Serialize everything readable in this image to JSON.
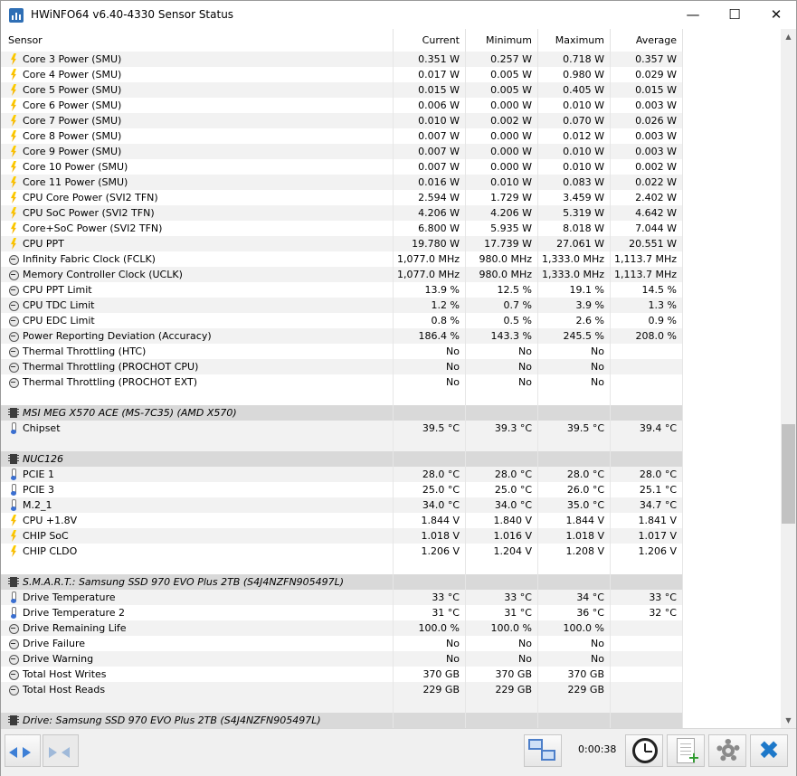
{
  "window": {
    "title": "HWiNFO64 v6.40-4330 Sensor Status",
    "controls": {
      "minimize": "—",
      "maximize": "☐",
      "close": "✕"
    }
  },
  "columns": {
    "sensor": "Sensor",
    "current": "Current",
    "minimum": "Minimum",
    "maximum": "Maximum",
    "average": "Average"
  },
  "rows": [
    {
      "kind": "sensor",
      "icon": "power",
      "name": "Core 3 Power (SMU)",
      "cur": "0.351 W",
      "min": "0.257 W",
      "max": "0.718 W",
      "avg": "0.357 W"
    },
    {
      "kind": "sensor",
      "icon": "power",
      "name": "Core 4 Power (SMU)",
      "cur": "0.017 W",
      "min": "0.005 W",
      "max": "0.980 W",
      "avg": "0.029 W"
    },
    {
      "kind": "sensor",
      "icon": "power",
      "name": "Core 5 Power (SMU)",
      "cur": "0.015 W",
      "min": "0.005 W",
      "max": "0.405 W",
      "avg": "0.015 W"
    },
    {
      "kind": "sensor",
      "icon": "power",
      "name": "Core 6 Power (SMU)",
      "cur": "0.006 W",
      "min": "0.000 W",
      "max": "0.010 W",
      "avg": "0.003 W"
    },
    {
      "kind": "sensor",
      "icon": "power",
      "name": "Core 7 Power (SMU)",
      "cur": "0.010 W",
      "min": "0.002 W",
      "max": "0.070 W",
      "avg": "0.026 W"
    },
    {
      "kind": "sensor",
      "icon": "power",
      "name": "Core 8 Power (SMU)",
      "cur": "0.007 W",
      "min": "0.000 W",
      "max": "0.012 W",
      "avg": "0.003 W"
    },
    {
      "kind": "sensor",
      "icon": "power",
      "name": "Core 9 Power (SMU)",
      "cur": "0.007 W",
      "min": "0.000 W",
      "max": "0.010 W",
      "avg": "0.003 W"
    },
    {
      "kind": "sensor",
      "icon": "power",
      "name": "Core 10 Power (SMU)",
      "cur": "0.007 W",
      "min": "0.000 W",
      "max": "0.010 W",
      "avg": "0.002 W"
    },
    {
      "kind": "sensor",
      "icon": "power",
      "name": "Core 11 Power (SMU)",
      "cur": "0.016 W",
      "min": "0.010 W",
      "max": "0.083 W",
      "avg": "0.022 W"
    },
    {
      "kind": "sensor",
      "icon": "power",
      "name": "CPU Core Power (SVI2 TFN)",
      "cur": "2.594 W",
      "min": "1.729 W",
      "max": "3.459 W",
      "avg": "2.402 W"
    },
    {
      "kind": "sensor",
      "icon": "power",
      "name": "CPU SoC Power (SVI2 TFN)",
      "cur": "4.206 W",
      "min": "4.206 W",
      "max": "5.319 W",
      "avg": "4.642 W"
    },
    {
      "kind": "sensor",
      "icon": "power",
      "name": "Core+SoC Power (SVI2 TFN)",
      "cur": "6.800 W",
      "min": "5.935 W",
      "max": "8.018 W",
      "avg": "7.044 W"
    },
    {
      "kind": "sensor",
      "icon": "power",
      "name": "CPU PPT",
      "cur": "19.780 W",
      "min": "17.739 W",
      "max": "27.061 W",
      "avg": "20.551 W"
    },
    {
      "kind": "sensor",
      "icon": "clock",
      "name": "Infinity Fabric Clock (FCLK)",
      "cur": "1,077.0 MHz",
      "min": "980.0 MHz",
      "max": "1,333.0 MHz",
      "avg": "1,113.7 MHz"
    },
    {
      "kind": "sensor",
      "icon": "clock",
      "name": "Memory Controller Clock (UCLK)",
      "cur": "1,077.0 MHz",
      "min": "980.0 MHz",
      "max": "1,333.0 MHz",
      "avg": "1,113.7 MHz"
    },
    {
      "kind": "sensor",
      "icon": "clock",
      "name": "CPU PPT Limit",
      "cur": "13.9 %",
      "min": "12.5 %",
      "max": "19.1 %",
      "avg": "14.5 %"
    },
    {
      "kind": "sensor",
      "icon": "clock",
      "name": "CPU TDC Limit",
      "cur": "1.2 %",
      "min": "0.7 %",
      "max": "3.9 %",
      "avg": "1.3 %"
    },
    {
      "kind": "sensor",
      "icon": "clock",
      "name": "CPU EDC Limit",
      "cur": "0.8 %",
      "min": "0.5 %",
      "max": "2.6 %",
      "avg": "0.9 %"
    },
    {
      "kind": "sensor",
      "icon": "clock",
      "name": "Power Reporting Deviation (Accuracy)",
      "cur": "186.4 %",
      "min": "143.3 %",
      "max": "245.5 %",
      "avg": "208.0 %"
    },
    {
      "kind": "sensor",
      "icon": "clock",
      "name": "Thermal Throttling (HTC)",
      "cur": "No",
      "min": "No",
      "max": "No",
      "avg": ""
    },
    {
      "kind": "sensor",
      "icon": "clock",
      "name": "Thermal Throttling (PROCHOT CPU)",
      "cur": "No",
      "min": "No",
      "max": "No",
      "avg": ""
    },
    {
      "kind": "sensor",
      "icon": "clock",
      "name": "Thermal Throttling (PROCHOT EXT)",
      "cur": "No",
      "min": "No",
      "max": "No",
      "avg": ""
    },
    {
      "kind": "blank"
    },
    {
      "kind": "group",
      "icon": "chip",
      "name": "MSI MEG X570 ACE (MS-7C35) (AMD X570)"
    },
    {
      "kind": "sensor",
      "icon": "temp",
      "name": "Chipset",
      "cur": "39.5 °C",
      "min": "39.3 °C",
      "max": "39.5 °C",
      "avg": "39.4 °C"
    },
    {
      "kind": "blank"
    },
    {
      "kind": "group",
      "icon": "chip",
      "name": "NUC126"
    },
    {
      "kind": "sensor",
      "icon": "temp",
      "name": "PCIE 1",
      "cur": "28.0 °C",
      "min": "28.0 °C",
      "max": "28.0 °C",
      "avg": "28.0 °C"
    },
    {
      "kind": "sensor",
      "icon": "temp",
      "name": "PCIE 3",
      "cur": "25.0 °C",
      "min": "25.0 °C",
      "max": "26.0 °C",
      "avg": "25.1 °C"
    },
    {
      "kind": "sensor",
      "icon": "temp",
      "name": "M.2_1",
      "cur": "34.0 °C",
      "min": "34.0 °C",
      "max": "35.0 °C",
      "avg": "34.7 °C"
    },
    {
      "kind": "sensor",
      "icon": "power",
      "name": "CPU +1.8V",
      "cur": "1.844 V",
      "min": "1.840 V",
      "max": "1.844 V",
      "avg": "1.841 V"
    },
    {
      "kind": "sensor",
      "icon": "power",
      "name": "CHIP SoC",
      "cur": "1.018 V",
      "min": "1.016 V",
      "max": "1.018 V",
      "avg": "1.017 V"
    },
    {
      "kind": "sensor",
      "icon": "power",
      "name": "CHIP CLDO",
      "cur": "1.206 V",
      "min": "1.204 V",
      "max": "1.208 V",
      "avg": "1.206 V"
    },
    {
      "kind": "blank"
    },
    {
      "kind": "group",
      "icon": "chip",
      "name": "S.M.A.R.T.: Samsung SSD 970 EVO Plus 2TB (S4J4NZFN905497L)"
    },
    {
      "kind": "sensor",
      "icon": "temp",
      "name": "Drive Temperature",
      "cur": "33 °C",
      "min": "33 °C",
      "max": "34 °C",
      "avg": "33 °C"
    },
    {
      "kind": "sensor",
      "icon": "temp",
      "name": "Drive Temperature 2",
      "cur": "31 °C",
      "min": "31 °C",
      "max": "36 °C",
      "avg": "32 °C"
    },
    {
      "kind": "sensor",
      "icon": "clock",
      "name": "Drive Remaining Life",
      "cur": "100.0 %",
      "min": "100.0 %",
      "max": "100.0 %",
      "avg": ""
    },
    {
      "kind": "sensor",
      "icon": "clock",
      "name": "Drive Failure",
      "cur": "No",
      "min": "No",
      "max": "No",
      "avg": ""
    },
    {
      "kind": "sensor",
      "icon": "clock",
      "name": "Drive Warning",
      "cur": "No",
      "min": "No",
      "max": "No",
      "avg": ""
    },
    {
      "kind": "sensor",
      "icon": "clock",
      "name": "Total Host Writes",
      "cur": "370 GB",
      "min": "370 GB",
      "max": "370 GB",
      "avg": ""
    },
    {
      "kind": "sensor",
      "icon": "clock",
      "name": "Total Host Reads",
      "cur": "229 GB",
      "min": "229 GB",
      "max": "229 GB",
      "avg": ""
    },
    {
      "kind": "blank"
    },
    {
      "kind": "group",
      "icon": "chip",
      "name": "Drive: Samsung SSD 970 EVO Plus 2TB (S4J4NZFN905497L)"
    }
  ],
  "footer": {
    "timer": "0:00:38",
    "buttons": {
      "nav_left": "navigate-arrows",
      "nav_right": "navigate-arrows-disabled",
      "network": "network-icon",
      "clock": "clock-icon",
      "report": "report-icon",
      "settings": "gear-icon",
      "exit": "close-icon"
    }
  },
  "colors": {
    "accent": "#1d78c9",
    "group_row": "#d9d9d9",
    "alt_row": "#f2f2f2"
  }
}
